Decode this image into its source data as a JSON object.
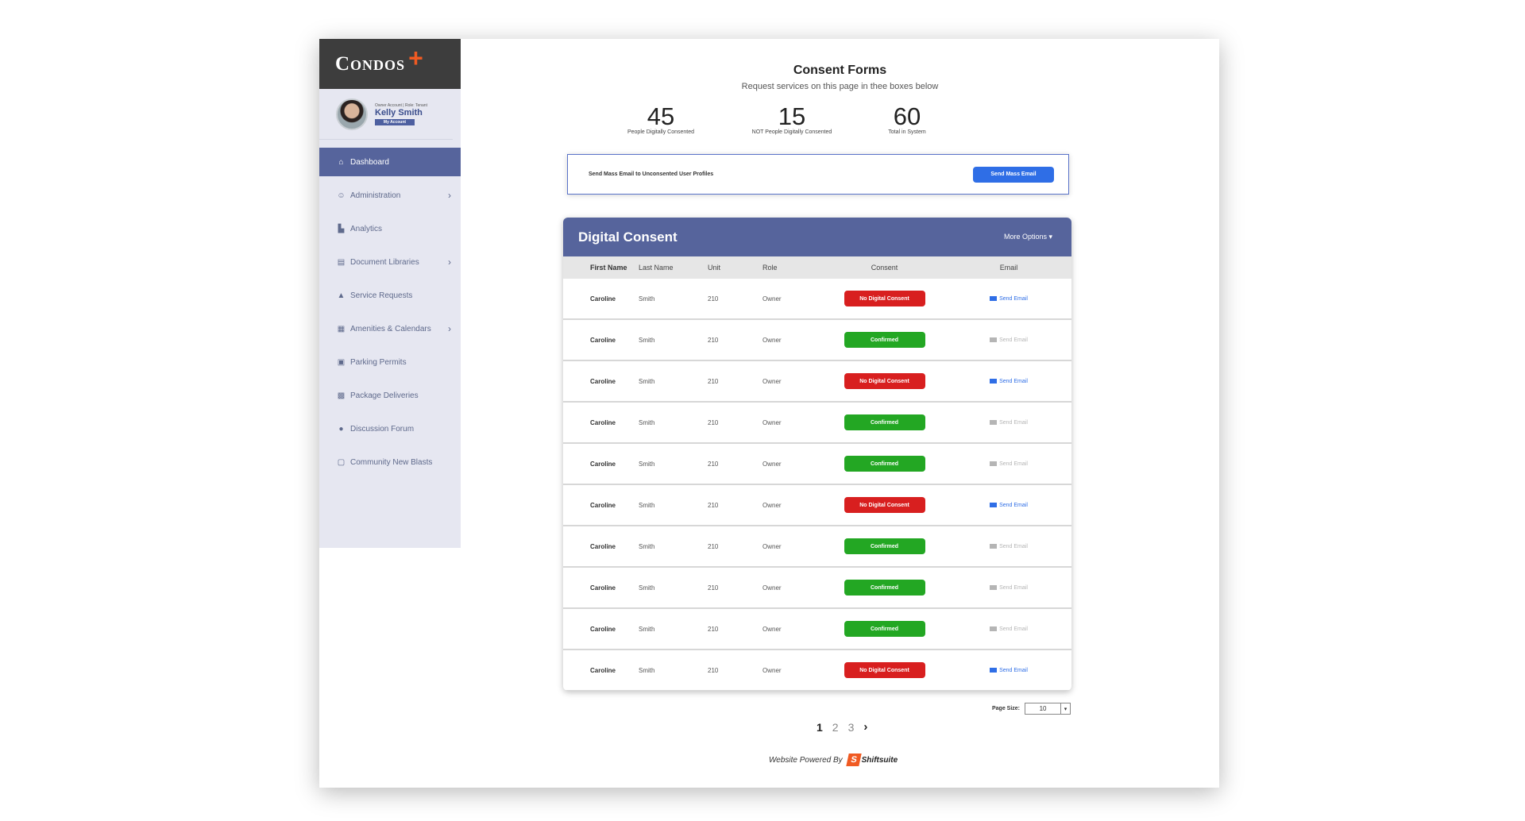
{
  "brand": {
    "logo_text": "Condos",
    "logo_accent": "+",
    "accent_color": "#f05a22",
    "primary_color": "#56649c"
  },
  "profile": {
    "role_line": "Owner Account | Role: Tenant",
    "name": "Kelly Smith",
    "account_button": "My Account"
  },
  "sidebar": {
    "items": [
      {
        "label": "Dashboard",
        "icon": "home-icon",
        "active": true,
        "chevron": false
      },
      {
        "label": "Administration",
        "icon": "user-gear-icon",
        "active": false,
        "chevron": true
      },
      {
        "label": "Analytics",
        "icon": "chart-icon",
        "active": false,
        "chevron": false
      },
      {
        "label": "Document Libraries",
        "icon": "book-icon",
        "active": false,
        "chevron": true
      },
      {
        "label": "Service Requests",
        "icon": "bell-icon",
        "active": false,
        "chevron": false
      },
      {
        "label": "Amenities & Calendars",
        "icon": "calendar-icon",
        "active": false,
        "chevron": true
      },
      {
        "label": "Parking Permits",
        "icon": "parking-icon",
        "active": false,
        "chevron": false
      },
      {
        "label": "Package Deliveries",
        "icon": "package-icon",
        "active": false,
        "chevron": false
      },
      {
        "label": "Discussion Forum",
        "icon": "chat-icon",
        "active": false,
        "chevron": false
      },
      {
        "label": "Community New Blasts",
        "icon": "inbox-icon",
        "active": false,
        "chevron": false
      }
    ]
  },
  "header": {
    "title": "Consent Forms",
    "subtitle": "Request services on this page in thee boxes below"
  },
  "stats": [
    {
      "value": "45",
      "label": "People Digitally Consented"
    },
    {
      "value": "15",
      "label": "NOT People Digitally Consented"
    },
    {
      "value": "60",
      "label": "Total in System"
    }
  ],
  "mass_email": {
    "text": "Send Mass Email to Unconsented User Profiles",
    "button": "Send Mass Email"
  },
  "table": {
    "title": "Digital Consent",
    "more_options": "More Options ▾",
    "columns": {
      "first": "First Name",
      "last": "Last Name",
      "unit": "Unit",
      "role": "Role",
      "consent": "Consent",
      "email": "Email"
    },
    "rows": [
      {
        "first": "Caroline",
        "last": "Smith",
        "unit": "210",
        "role": "Owner",
        "consent": "No Digital Consent",
        "status": "no",
        "email": "Send Email"
      },
      {
        "first": "Caroline",
        "last": "Smith",
        "unit": "210",
        "role": "Owner",
        "consent": "Confirmed",
        "status": "ok",
        "email": "Send Email"
      },
      {
        "first": "Caroline",
        "last": "Smith",
        "unit": "210",
        "role": "Owner",
        "consent": "No Digital Consent",
        "status": "no",
        "email": "Send Email"
      },
      {
        "first": "Caroline",
        "last": "Smith",
        "unit": "210",
        "role": "Owner",
        "consent": "Confirmed",
        "status": "ok",
        "email": "Send Email"
      },
      {
        "first": "Caroline",
        "last": "Smith",
        "unit": "210",
        "role": "Owner",
        "consent": "Confirmed",
        "status": "ok",
        "email": "Send Email"
      },
      {
        "first": "Caroline",
        "last": "Smith",
        "unit": "210",
        "role": "Owner",
        "consent": "No Digital Consent",
        "status": "no",
        "email": "Send Email"
      },
      {
        "first": "Caroline",
        "last": "Smith",
        "unit": "210",
        "role": "Owner",
        "consent": "Confirmed",
        "status": "ok",
        "email": "Send Email"
      },
      {
        "first": "Caroline",
        "last": "Smith",
        "unit": "210",
        "role": "Owner",
        "consent": "Confirmed",
        "status": "ok",
        "email": "Send Email"
      },
      {
        "first": "Caroline",
        "last": "Smith",
        "unit": "210",
        "role": "Owner",
        "consent": "Confirmed",
        "status": "ok",
        "email": "Send Email"
      },
      {
        "first": "Caroline",
        "last": "Smith",
        "unit": "210",
        "role": "Owner",
        "consent": "No Digital Consent",
        "status": "no",
        "email": "Send Email"
      }
    ]
  },
  "pagination": {
    "page_size_label": "Page Size:",
    "page_size": "10",
    "pages": [
      "1",
      "2",
      "3"
    ],
    "current": "1",
    "next": "›"
  },
  "footer": {
    "powered_by": "Website Powered By",
    "brand": "Shiftsuite"
  }
}
